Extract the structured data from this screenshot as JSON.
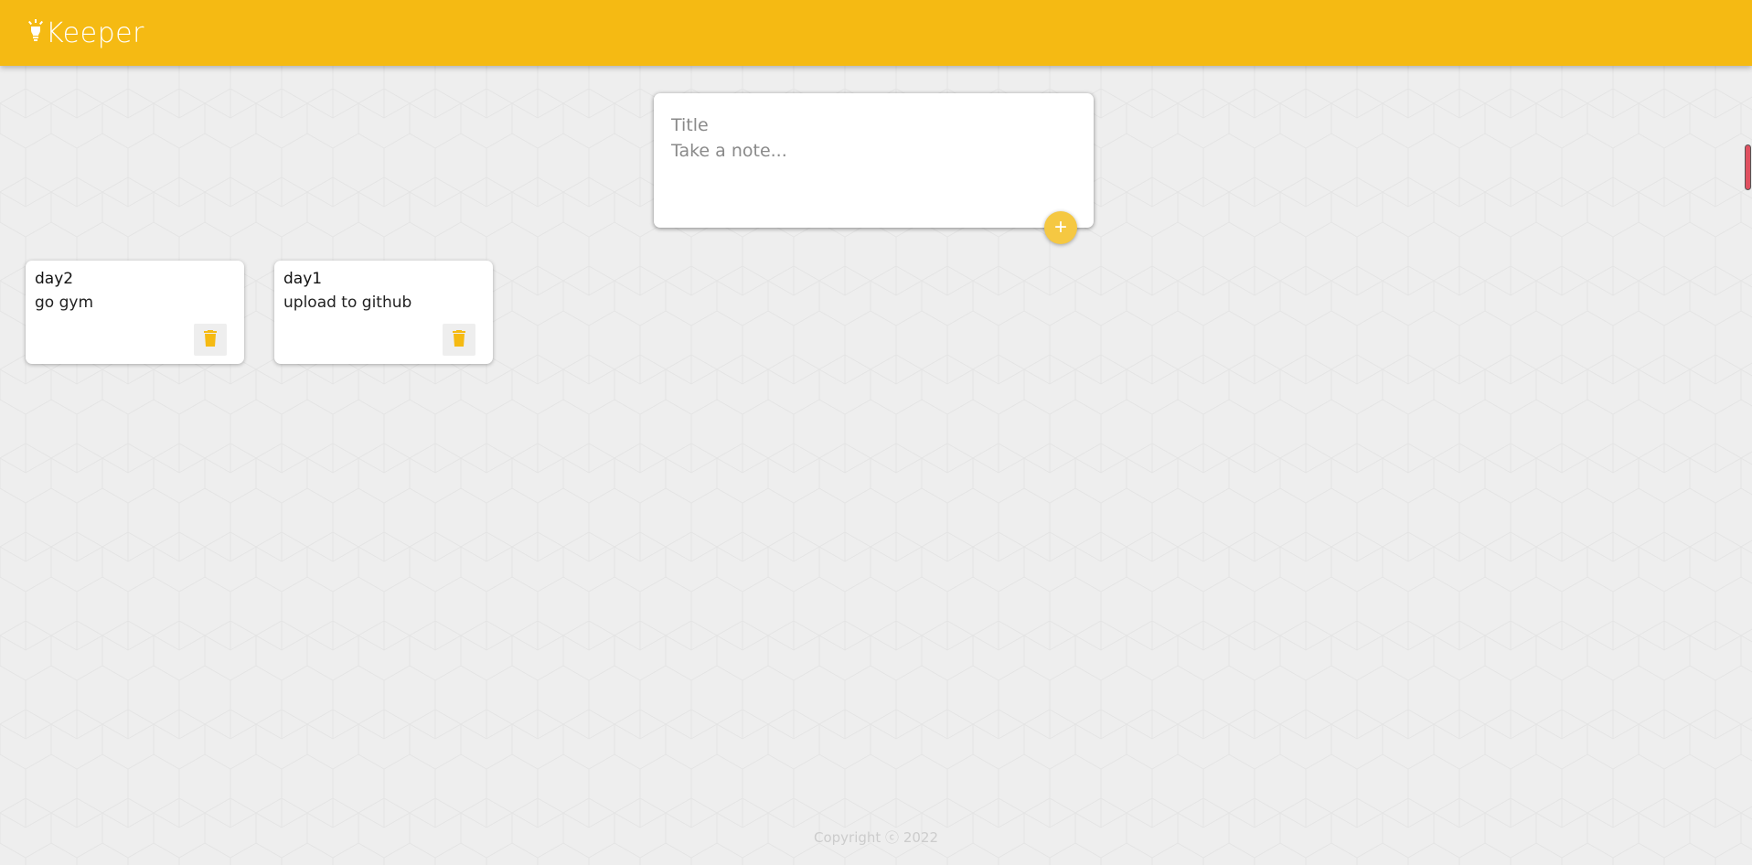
{
  "colors": {
    "accent": "#f5ba13",
    "background": "#eeeeee",
    "add_button": "#f5c842",
    "footer_text": "#cccccc"
  },
  "header": {
    "title": "Keeper",
    "logo_icon": "lightbulb-icon"
  },
  "create_note": {
    "title_placeholder": "Title",
    "content_placeholder": "Take a note...",
    "add_label": "+"
  },
  "notes": [
    {
      "title": "day2",
      "content": "go gym",
      "delete_icon": "trash-icon"
    },
    {
      "title": "day1",
      "content": "upload to github",
      "delete_icon": "trash-icon"
    }
  ],
  "footer": {
    "copyright": "Copyright ⓒ 2022"
  }
}
